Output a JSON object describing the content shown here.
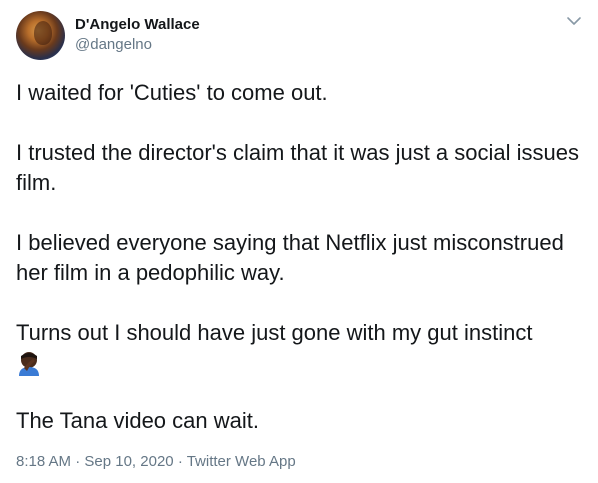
{
  "user": {
    "display_name": "D'Angelo Wallace",
    "handle": "@dangelno"
  },
  "tweet": {
    "paragraphs": [
      "I waited for 'Cuties' to come out.",
      "I trusted the director's claim that it was just a social issues film.",
      "I believed everyone saying that Netflix just misconstrued her film in a pedophilic way.",
      "Turns out I should have just gone with my gut instinct",
      "The Tana video can wait."
    ],
    "emoji": "facepalm-emoji"
  },
  "meta": {
    "time": "8:18 AM",
    "separator": "·",
    "date": "Sep 10, 2020",
    "source": "Twitter Web App"
  },
  "icons": {
    "menu": "chevron-down-icon"
  },
  "colors": {
    "text": "#14171a",
    "secondary": "#657786"
  }
}
